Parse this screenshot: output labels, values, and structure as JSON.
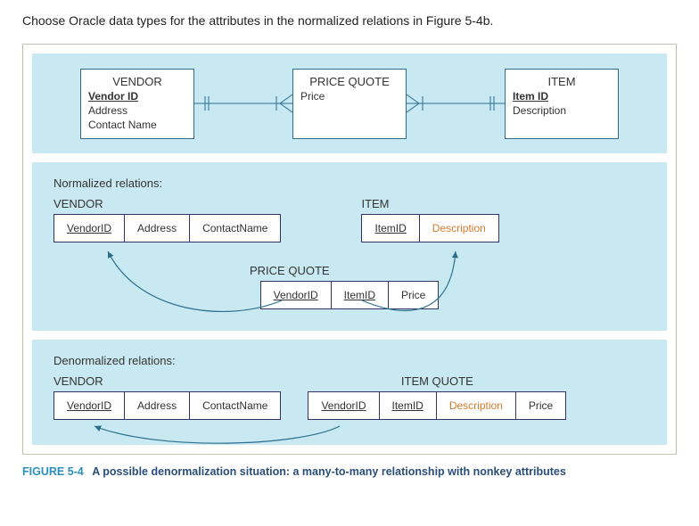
{
  "question": "Choose Oracle data types for the attributes in the normalized relations in Figure 5-4b.",
  "erd": {
    "vendor": {
      "title": "VENDOR",
      "pk": "Vendor ID",
      "attrs": [
        "Address",
        "Contact Name"
      ]
    },
    "priceQuote": {
      "title": "PRICE QUOTE",
      "attrs": [
        "Price"
      ]
    },
    "item": {
      "title": "ITEM",
      "pk": "Item ID",
      "attrs": [
        "Description"
      ]
    }
  },
  "normalized": {
    "label": "Normalized relations:",
    "vendor": {
      "name": "VENDOR",
      "cols": [
        {
          "label": "VendorID",
          "pk": true
        },
        {
          "label": "Address"
        },
        {
          "label": "ContactName"
        }
      ]
    },
    "item": {
      "name": "ITEM",
      "cols": [
        {
          "label": "ItemID",
          "pk": true
        },
        {
          "label": "Description",
          "orange": true
        }
      ]
    },
    "priceQuote": {
      "name": "PRICE QUOTE",
      "cols": [
        {
          "label": "VendorID",
          "pk": true
        },
        {
          "label": "ItemID",
          "pk": true
        },
        {
          "label": "Price"
        }
      ]
    }
  },
  "denormalized": {
    "label": "Denormalized relations:",
    "vendor": {
      "name": "VENDOR",
      "cols": [
        {
          "label": "VendorID",
          "pk": true
        },
        {
          "label": "Address"
        },
        {
          "label": "ContactName"
        }
      ]
    },
    "itemQuote": {
      "name": "ITEM QUOTE",
      "cols": [
        {
          "label": "VendorID",
          "pk": true
        },
        {
          "label": "ItemID",
          "pk": true
        },
        {
          "label": "Description",
          "orange": true
        },
        {
          "label": "Price"
        }
      ]
    }
  },
  "caption": {
    "num": "FIGURE 5-4",
    "text": "A possible denormalization situation: a many-to-many relationship with nonkey attributes"
  }
}
